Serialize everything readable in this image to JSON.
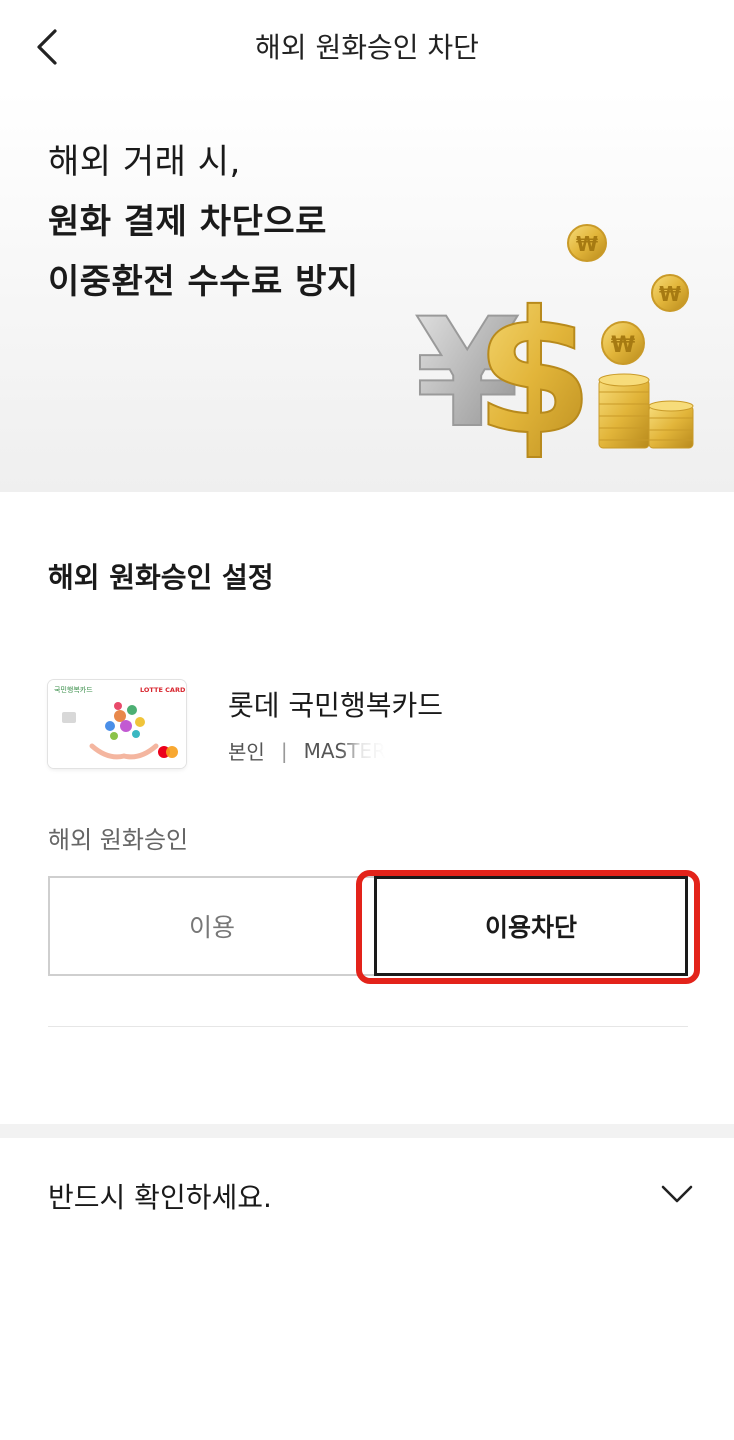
{
  "header": {
    "title": "해외 원화승인 차단",
    "back_icon": "chevron-left-icon"
  },
  "hero": {
    "line1": "해외 거래 시,",
    "line2": "원화 결제 차단으로",
    "line3": "이중환전 수수료 방지",
    "coin_symbol": "₩"
  },
  "settings": {
    "title": "해외 원화승인 설정",
    "card": {
      "name": "롯데 국민행복카드",
      "owner": "본인",
      "separator": "|",
      "number_masked": "MASTER",
      "brand_text": "LOTTE CARD",
      "card_label": "국민행복카드"
    },
    "field_label": "해외 원화승인",
    "options": [
      {
        "label": "이용",
        "selected": false
      },
      {
        "label": "이용차단",
        "selected": true
      }
    ],
    "highlight_color": "#e3231a"
  },
  "notice": {
    "label": "반드시 확인하세요.",
    "chevron_icon": "chevron-down-icon"
  },
  "colors": {
    "accent_gold": "#e2b53a",
    "silver": "#b8b8b8",
    "text": "#1a1a1a"
  }
}
